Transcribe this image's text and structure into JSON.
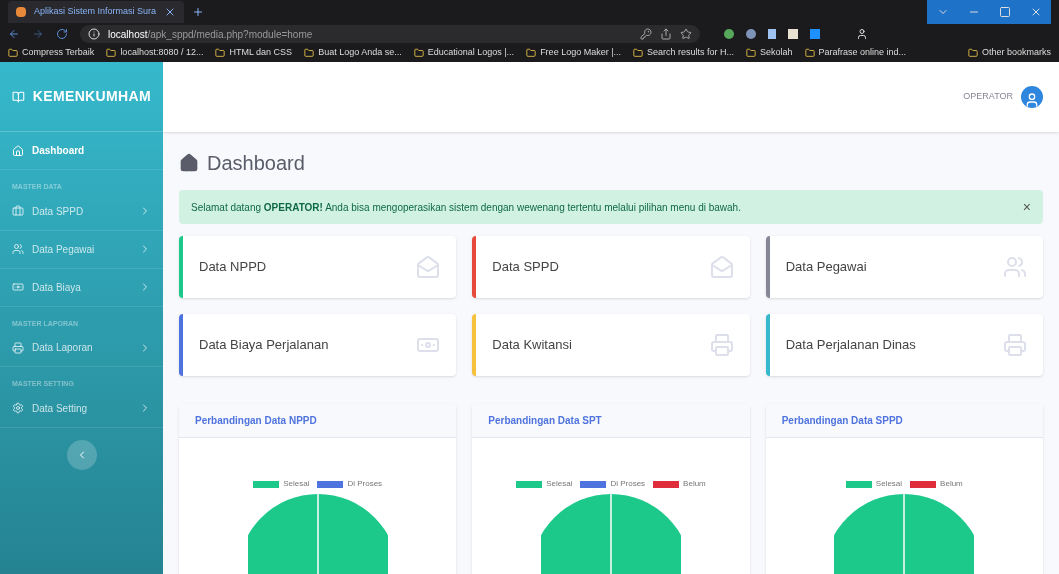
{
  "browser": {
    "tab_title": "Aplikasi Sistem Informasi Sura",
    "url_host": "localhost",
    "url_path": "/apk_sppd/media.php?module=home",
    "bookmarks": [
      "Compress Terbaik",
      "localhost:8080 / 12...",
      "HTML dan CSS",
      "Buat Logo Anda se...",
      "Educational Logos |...",
      "Free Logo Maker |...",
      "Search results for H...",
      "Sekolah",
      "Parafrase online ind..."
    ],
    "other_bookmarks": "Other bookmarks"
  },
  "sidebar": {
    "brand": "KEMENKUMHAM",
    "items": [
      {
        "kind": "link",
        "label": "Dashboard",
        "selected": true
      },
      {
        "kind": "heading",
        "label": "MASTER DATA"
      },
      {
        "kind": "link",
        "label": "Data SPPD",
        "selected": false
      },
      {
        "kind": "link",
        "label": "Data Pegawai",
        "selected": false
      },
      {
        "kind": "link",
        "label": "Data Biaya",
        "selected": false
      },
      {
        "kind": "heading",
        "label": "MASTER LAPORAN"
      },
      {
        "kind": "link",
        "label": "Data Laporan",
        "selected": false
      },
      {
        "kind": "heading",
        "label": "MASTER SETTING"
      },
      {
        "kind": "link",
        "label": "Data Setting",
        "selected": false
      }
    ]
  },
  "topbar": {
    "user": "OPERATOR"
  },
  "page_title": "Dashboard",
  "alert": {
    "text": "Selamat datang **OPERATOR!** Anda bisa mengoperasikan sistem dengan wewenang tertentu melalui pilihan menu di bawah.",
    "close": "×"
  },
  "cards": [
    {
      "label": "Data NPPD",
      "color": "#1cc88a"
    },
    {
      "label": "Data SPPD",
      "color": "#e74a3b"
    },
    {
      "label": "Data Pegawai",
      "color": "#858796"
    },
    {
      "label": "Data Biaya Perjalanan",
      "color": "#4e73df"
    },
    {
      "label": "Data Kwitansi",
      "color": "#f6c23e"
    },
    {
      "label": "Data Perjalanan Dinas",
      "color": "#36b9cc"
    }
  ],
  "charts": [
    {
      "title": "Perbandingan Data NPPD",
      "legend": [
        {
          "label": "Selesai",
          "color": "#1cc88a"
        },
        {
          "label": "Di Proses",
          "color": "#4e73df"
        }
      ]
    },
    {
      "title": "Perbandingan Data SPT",
      "legend": [
        {
          "label": "Selesai",
          "color": "#1cc88a"
        },
        {
          "label": "Di Proses",
          "color": "#4e73df"
        },
        {
          "label": "Belum",
          "color": "#e02d3c"
        }
      ]
    },
    {
      "title": "Perbandingan Data SPPD",
      "legend": [
        {
          "label": "Selesai",
          "color": "#1cc88a"
        },
        {
          "label": "Belum",
          "color": "#e02d3c"
        }
      ]
    }
  ]
}
